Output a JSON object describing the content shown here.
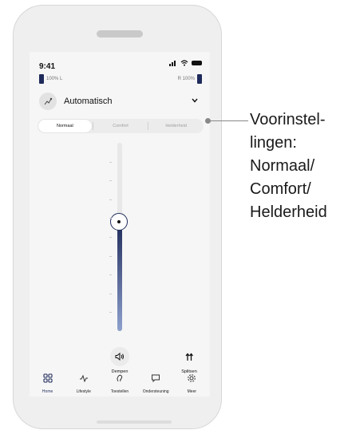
{
  "status": {
    "time": "9:41"
  },
  "battery": {
    "left": "100% L",
    "right": "R 100%"
  },
  "program": {
    "name": "Automatisch"
  },
  "segments": [
    {
      "label": "Normaal",
      "active": true
    },
    {
      "label": "Comfort",
      "active": false
    },
    {
      "label": "Helderheid",
      "active": false
    }
  ],
  "slider": {
    "value_fraction": 0.58
  },
  "quick_actions": {
    "mute_label": "Dempen",
    "split_label": "Splitsen"
  },
  "tabs": [
    {
      "label": "Home",
      "icon": "grid-icon",
      "active": true
    },
    {
      "label": "Lifestyle",
      "icon": "activity-icon",
      "active": false
    },
    {
      "label": "Toestellen",
      "icon": "hearing-aid-icon",
      "active": false
    },
    {
      "label": "Ondersteuning",
      "icon": "chat-icon",
      "active": false
    },
    {
      "label": "Meer",
      "icon": "gear-icon",
      "active": false
    }
  ],
  "callout": {
    "lines": [
      "Voorinstel-",
      "lingen:",
      "Normaal/",
      "Comfort/",
      "Helderheid"
    ]
  },
  "colors": {
    "accent": "#1f2b5b",
    "accent_light": "#8ea1cd"
  }
}
